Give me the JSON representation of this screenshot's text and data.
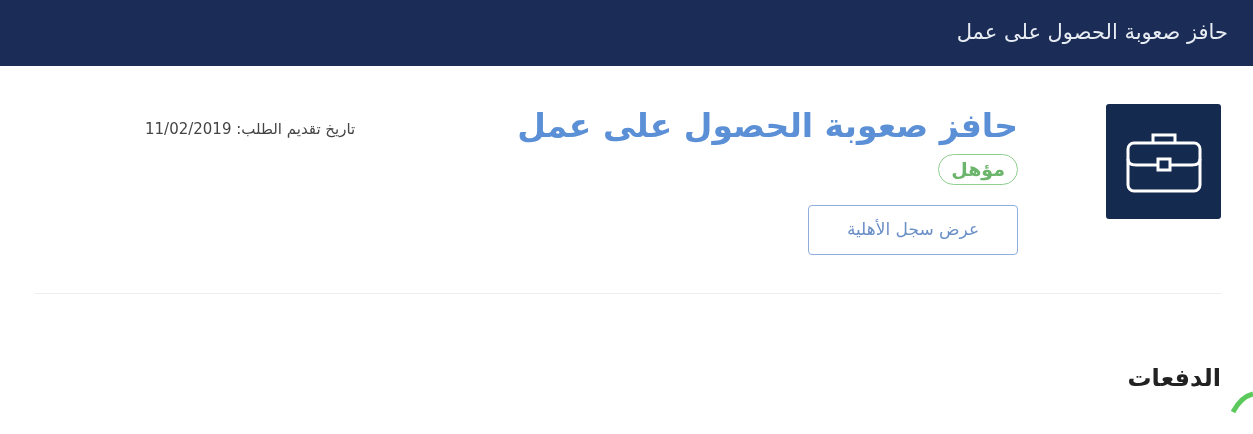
{
  "header": {
    "title": "حافز صعوبة الحصول على عمل"
  },
  "program": {
    "title": "حافز صعوبة الحصول على عمل",
    "status": {
      "label": "مؤهل",
      "kind": "eligible"
    },
    "button": "عرض سجل الأهلية",
    "date_label": "تاريخ تقديم الطلب:",
    "date_value": "11/02/2019"
  },
  "payments": {
    "title": "الدفعات"
  }
}
